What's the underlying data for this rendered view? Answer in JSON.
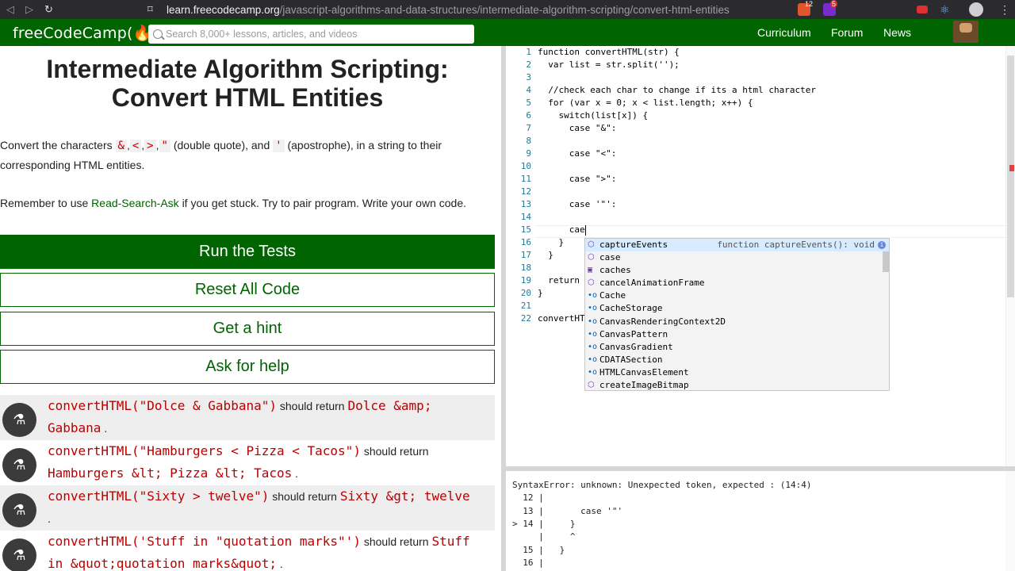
{
  "browser": {
    "url_host": "learn.freecodecamp.org",
    "url_path": "/javascript-algorithms-and-data-structures/intermediate-algorithm-scripting/convert-html-entities",
    "brave_count": "12",
    "ext_count": "5"
  },
  "nav": {
    "logo": "freeCodeCamp(🔥)",
    "search_placeholder": "Search 8,000+ lessons, articles, and videos",
    "links": [
      "Curriculum",
      "Forum",
      "News"
    ]
  },
  "challenge": {
    "title": "Intermediate Algorithm Scripting: Convert HTML Entities",
    "desc_prefix": "Convert the characters",
    "chars": [
      "&",
      "<",
      ">",
      "\""
    ],
    "desc_mid1": "(double quote), and",
    "apostrophe": "'",
    "desc_mid2": "(apostrophe), in a string to their corresponding HTML entities.",
    "remember_prefix": "Remember to use",
    "remember_link": "Read-Search-Ask",
    "remember_suffix": "if you get stuck. Try to pair program. Write your own code.",
    "buttons": {
      "run": "Run the Tests",
      "reset": "Reset All Code",
      "hint": "Get a hint",
      "help": "Ask for help"
    },
    "should_return": "should return",
    "tests": [
      {
        "call": "convertHTML(\"Dolce & Gabbana\")",
        "result": "Dolce &amp; Gabbana"
      },
      {
        "call": "convertHTML(\"Hamburgers < Pizza < Tacos\")",
        "result": "Hamburgers &lt; Pizza &lt; Tacos"
      },
      {
        "call": "convertHTML(\"Sixty > twelve\")",
        "result": "Sixty &gt; twelve"
      },
      {
        "call": "convertHTML('Stuff in \"quotation marks\"')",
        "result": "Stuff in &quot;quotation marks&quot;"
      }
    ]
  },
  "editor": {
    "lines": [
      "function convertHTML(str) {",
      "  var list = str.split('');",
      "",
      "  //check each char to change if its a html character",
      "  for (var x = 0; x < list.length; x++) {",
      "    switch(list[x]) {",
      "      case \"&\":",
      "",
      "      case \"<\":",
      "",
      "      case \">\":",
      "",
      "      case '\"':",
      "",
      "      cae",
      "    }",
      "  }",
      "",
      "  return",
      "}",
      "",
      "convertHT"
    ],
    "suggestions": [
      {
        "label": "captureEvents",
        "icon": "cube-icon",
        "detail": "function captureEvents(): void"
      },
      {
        "label": "case",
        "icon": "cube-icon"
      },
      {
        "label": "caches",
        "icon": "field-icon"
      },
      {
        "label": "cancelAnimationFrame",
        "icon": "cube-icon"
      },
      {
        "label": "Cache",
        "icon": "variable-icon"
      },
      {
        "label": "CacheStorage",
        "icon": "variable-icon"
      },
      {
        "label": "CanvasRenderingContext2D",
        "icon": "variable-icon"
      },
      {
        "label": "CanvasPattern",
        "icon": "variable-icon"
      },
      {
        "label": "CanvasGradient",
        "icon": "variable-icon"
      },
      {
        "label": "CDATASection",
        "icon": "variable-icon"
      },
      {
        "label": "HTMLCanvasElement",
        "icon": "variable-icon"
      },
      {
        "label": "createImageBitmap",
        "icon": "cube-icon"
      }
    ]
  },
  "console": {
    "lines": [
      "SyntaxError: unknown: Unexpected token, expected : (14:4)",
      "  12 |",
      "  13 |       case '\"'",
      "> 14 |     }",
      "     |     ^",
      "  15 |   }",
      "  16 |"
    ]
  }
}
